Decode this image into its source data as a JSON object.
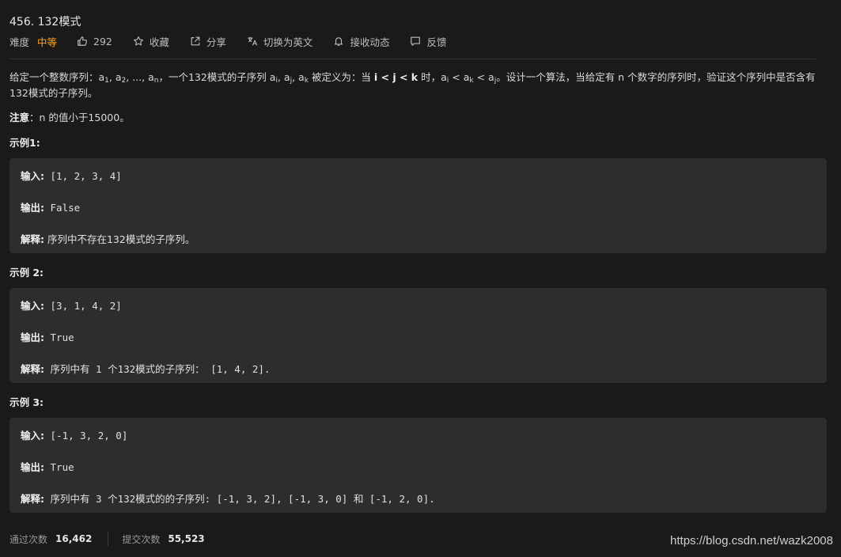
{
  "problem": {
    "title": "456. 132模式",
    "difficulty_label": "难度",
    "difficulty": "中等",
    "likes": "292",
    "favorite_label": "收藏",
    "share_label": "分享",
    "switch_lang_label": "切换为英文",
    "subscribe_label": "接收动态",
    "feedback_label": "反馈"
  },
  "description": {
    "p1_a": "给定一个整数序列：a",
    "sub_1": "1",
    "p1_b": ", a",
    "sub_2": "2",
    "p1_c": ", ..., a",
    "sub_n": "n",
    "p1_d": "，一个132模式的子序列 a",
    "sub_i": "i",
    "p1_e": ", a",
    "sub_j": "j",
    "p1_f": ", a",
    "sub_k": "k",
    "p1_g": " 被定义为：当 ",
    "cond": "i < j < k",
    "p1_h": " 时，a",
    "sub_i2": "i",
    "p1_i": " < a",
    "sub_k2": "k",
    "p1_j": " < a",
    "sub_j2": "j",
    "p1_k": "。设计一个算法，当给定有 n 个数字的序列时，验证这个序列中是否含有132模式的子序列。",
    "note_label": "注意",
    "note_text": "：n 的值小于15000。"
  },
  "examples": [
    {
      "title": "示例1:",
      "input_label": "输入:",
      "input": " [1, 2, 3, 4]",
      "output_label": "输出:",
      "output": " False",
      "explain_label": "解释:",
      "explain": " 序列中不存在132模式的子序列。"
    },
    {
      "title": "示例 2:",
      "input_label": "输入:",
      "input": " [3, 1, 4, 2]",
      "output_label": "输出:",
      "output": " True",
      "explain_label": "解释:",
      "explain": " 序列中有 1 个132模式的子序列： [1, 4, 2]."
    },
    {
      "title": "示例 3:",
      "input_label": "输入:",
      "input": " [-1, 3, 2, 0]",
      "output_label": "输出:",
      "output": " True",
      "explain_label": "解释:",
      "explain": " 序列中有 3 个132模式的的子序列: [-1, 3, 2], [-1, 3, 0] 和 [-1, 2, 0]."
    }
  ],
  "stats": {
    "accepted_label": "通过次数",
    "accepted": "16,462",
    "submissions_label": "提交次数",
    "submissions": "55,523"
  },
  "watermark": "https://blog.csdn.net/wazk2008",
  "colors": {
    "background": "#1a1a1a",
    "example_box": "#2d2d2d",
    "difficulty_medium": "#ffa116"
  }
}
